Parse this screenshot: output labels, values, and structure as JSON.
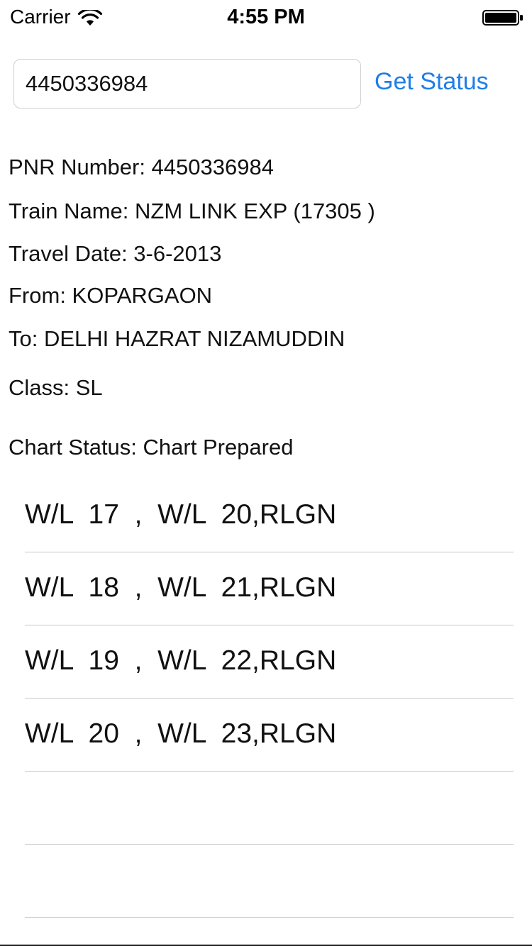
{
  "status_bar": {
    "carrier": "Carrier",
    "time": "4:55 PM",
    "wifi_icon": "wifi-icon",
    "battery_icon": "battery-icon"
  },
  "search": {
    "pnr_value": "4450336984",
    "button_label": "Get Status"
  },
  "details": {
    "pnr_number": "PNR Number: 4450336984",
    "train_name": "Train Name: NZM LINK EXP (17305 )",
    "travel_date": "Travel Date: 3-6-2013",
    "from": "From: KOPARGAON",
    "to": "To: DELHI HAZRAT NIZAMUDDIN",
    "class": "Class: SL",
    "chart_status": "Chart Status: Chart Prepared"
  },
  "passengers": [
    "W/L  17  ,  W/L  20,RLGN",
    "W/L  18  ,  W/L  21,RLGN",
    "W/L  19  ,  W/L  22,RLGN",
    "W/L  20  ,  W/L  23,RLGN",
    "",
    ""
  ],
  "colors": {
    "accent": "#1e7fe6",
    "text": "#111111",
    "separator": "#c8c8c8"
  }
}
